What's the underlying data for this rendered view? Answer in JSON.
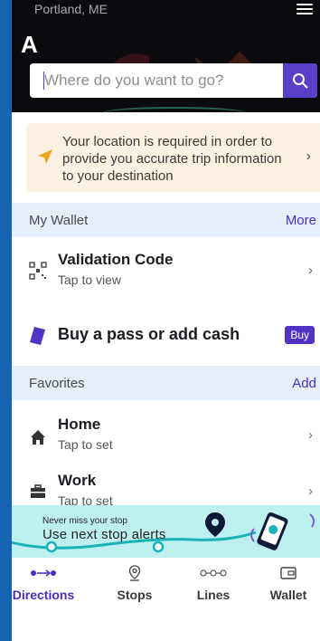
{
  "header": {
    "city": "Portland, ME",
    "label": "A",
    "menu_icon": "hamburger-menu-icon"
  },
  "search": {
    "placeholder": "Where do you want to go?",
    "value": "",
    "button_icon": "search-icon"
  },
  "location_notice": {
    "icon": "location-arrow-icon",
    "text": "Your location is required in order to provide you accurate trip information to your destination",
    "accent": "#f0a21a"
  },
  "wallet": {
    "title": "My Wallet",
    "action": "More",
    "items": [
      {
        "title": "Validation Code",
        "subtitle": "Tap to view",
        "icon": "qr-code-icon"
      },
      {
        "title": "Buy a pass or add cash",
        "badge": "Buy",
        "icon": "ticket-icon"
      }
    ]
  },
  "favorites": {
    "title": "Favorites",
    "action": "Add",
    "items": [
      {
        "title": "Home",
        "subtitle": "Tap to set",
        "icon": "home-icon"
      },
      {
        "title": "Work",
        "subtitle": "Tap to set",
        "icon": "briefcase-icon"
      }
    ]
  },
  "banner": {
    "small": "Never miss your stop",
    "big": "Use next stop alerts"
  },
  "tabs": [
    {
      "label": "Directions",
      "icon": "directions-icon",
      "active": true
    },
    {
      "label": "Stops",
      "icon": "stop-pin-icon",
      "active": false
    },
    {
      "label": "Lines",
      "icon": "lines-icon",
      "active": false
    },
    {
      "label": "Wallet",
      "icon": "wallet-icon",
      "active": false
    }
  ],
  "colors": {
    "brand": "#5a3fc9",
    "section_bg": "#e6eefb",
    "notice_bg": "#fbf1e1",
    "banner_bg": "#bdf0ef",
    "left_bar": "#1663b0"
  }
}
